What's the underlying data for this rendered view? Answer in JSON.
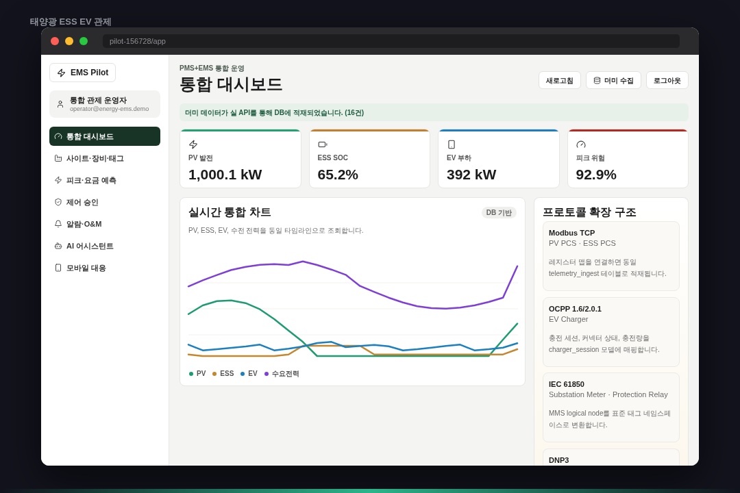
{
  "page": {
    "caption": "태양광 ESS EV 관제"
  },
  "window": {
    "url": "pilot-156728/app"
  },
  "sidebar": {
    "brand": "EMS Pilot",
    "user": {
      "name": "통합 관제 운영자",
      "email": "operator@energy-ems.demo"
    },
    "items": [
      {
        "label": "통합 대시보드",
        "selected": true
      },
      {
        "label": "사이트·장비·태그",
        "selected": false
      },
      {
        "label": "피크·요금 예측",
        "selected": false
      },
      {
        "label": "제어 승인",
        "selected": false
      },
      {
        "label": "알람·O&M",
        "selected": false
      },
      {
        "label": "AI 어시스턴트",
        "selected": false
      },
      {
        "label": "모바일 대응",
        "selected": false
      }
    ]
  },
  "header": {
    "eyebrow": "PMS+EMS 통합 운영",
    "title": "통합 대시보드",
    "buttons": [
      {
        "label": "새로고침",
        "kind": "plain"
      },
      {
        "label": "더미 수집",
        "kind": "with-icon"
      },
      {
        "label": "로그아웃",
        "kind": "plain"
      }
    ]
  },
  "notice": "더미 데이터가 실 API를 통해 DB에 적재되었습니다. (16건)",
  "kpis": [
    {
      "label": "PV 발전",
      "value": "1,000.1 kW",
      "color": "#23a074"
    },
    {
      "label": "ESS SOC",
      "value": "65.2%",
      "color": "#c27f2e"
    },
    {
      "label": "EV 부하",
      "value": "392 kW",
      "color": "#1c7fc0"
    },
    {
      "label": "피크 위험",
      "value": "92.9%",
      "color": "#b42a22"
    }
  ],
  "chart": {
    "title": "실시간 통합 차트",
    "badge": "DB 기반",
    "subtitle": "PV, ESS, EV, 수전 전력을 동일 타임라인으로 조회합니다.",
    "legend": [
      {
        "name": "PV",
        "color": "#1e9b70"
      },
      {
        "name": "ESS",
        "color": "#c4872f"
      },
      {
        "name": "EV",
        "color": "#1b80c2"
      },
      {
        "name": "수요전력",
        "color": "#7e3fd8"
      }
    ]
  },
  "protocols": {
    "title": "프로토콜 확장 구조",
    "items": [
      {
        "name": "Modbus TCP",
        "devices": "PV PCS · ESS PCS",
        "description": "레지스터 맵을 연결하면 동일 telemetry_ingest 테이블로 적재됩니다."
      },
      {
        "name": "OCPP 1.6/2.0.1",
        "devices": "EV Charger",
        "description": "충전 세션, 커넥터 상태, 충전량을 charger_session 모델에 매핑합니다."
      },
      {
        "name": "IEC 61850",
        "devices": "Substation Meter · Protection Relay",
        "description": "MMS logical node를 표준 태그 네임스페이스로 변환합니다."
      },
      {
        "name": "DNP3"
      }
    ]
  }
}
